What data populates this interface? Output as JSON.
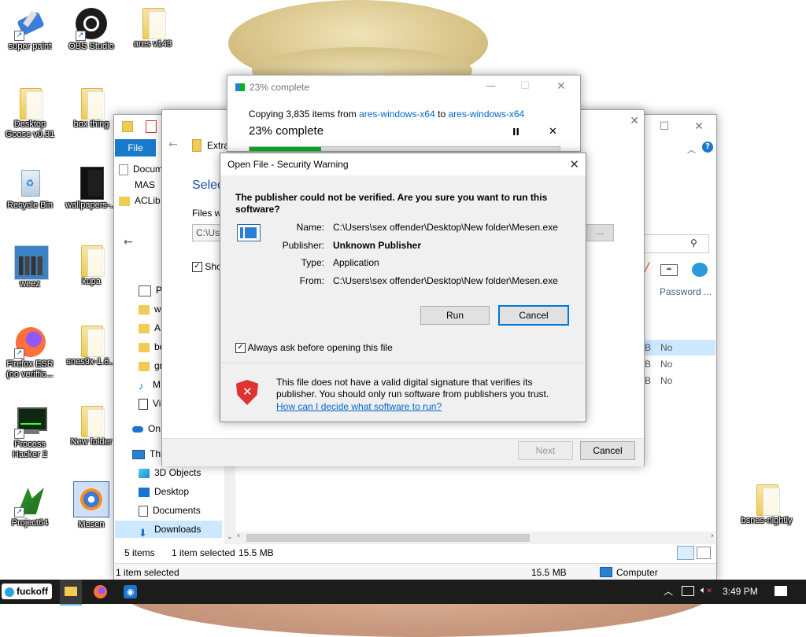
{
  "desktop": {
    "icons": [
      {
        "label": "super paint"
      },
      {
        "label": "OBS Studio"
      },
      {
        "label": "ares v143"
      },
      {
        "label": "Desktop\nGoose v0.31"
      },
      {
        "label": "box thing"
      },
      {
        "label": "Recycle Bin"
      },
      {
        "label": "wallpapers-..."
      },
      {
        "label": "weez"
      },
      {
        "label": "kupa"
      },
      {
        "label": "Firefox ESR\n(no veriffic..."
      },
      {
        "label": "snes9x-1.6..."
      },
      {
        "label": "Process\nHacker 2"
      },
      {
        "label": "New folder"
      },
      {
        "label": "Project64"
      },
      {
        "label": "Mesen"
      },
      {
        "label": "bsnes-nightly"
      }
    ]
  },
  "copy_dialog": {
    "title": "23% complete",
    "copying_prefix": "Copying 3,835 items from",
    "source": "ares-windows-x64",
    "to_word": "to",
    "destination": "ares-windows-x64",
    "progress_text": "23% complete",
    "progress_fraction": 0.23,
    "pause_label": "II",
    "cancel_label": "✕"
  },
  "extract_wizard": {
    "title": "Extra",
    "heading": "Selec",
    "files_label": "Files w",
    "path_value": "C:\\Us",
    "show_label": "Sho",
    "next_label": "Next",
    "cancel_label": "Cancel"
  },
  "explorer": {
    "file_tab": "File",
    "quick_items": [
      "Docum",
      "MAS",
      "ACLib"
    ],
    "nav_items": [
      "Pi",
      "w",
      "A",
      "be",
      "gr",
      "M",
      "Vi"
    ],
    "onedrive": "On",
    "thispc": "Thi",
    "locations": [
      "3D Objects",
      "Desktop",
      "Documents",
      "Downloads"
    ],
    "column_header": "Password ...",
    "rows": [
      {
        "size_tail": "B",
        "password": "No"
      },
      {
        "size_tail": "B",
        "password": "No"
      },
      {
        "size_tail": "B",
        "password": "No"
      }
    ],
    "status_items": "5 items",
    "status_selected": "1 item selected",
    "status_size": "15.5 MB",
    "bottom_selected": "1 item selected",
    "bottom_size": "15.5 MB",
    "bottom_location": "Computer"
  },
  "security_dialog": {
    "title": "Open File - Security Warning",
    "question": "The publisher could not be verified.  Are you sure you want to run this software?",
    "name_label": "Name:",
    "name_value": "C:\\Users\\sex offender\\Desktop\\New folder\\Mesen.exe",
    "publisher_label": "Publisher:",
    "publisher_value": "Unknown Publisher",
    "type_label": "Type:",
    "type_value": "Application",
    "from_label": "From:",
    "from_value": "C:\\Users\\sex offender\\Desktop\\New folder\\Mesen.exe",
    "run_label": "Run",
    "cancel_label": "Cancel",
    "always_ask_label": "Always ask before opening this file",
    "always_ask_checked": true,
    "warning_text": "This file does not have a valid digital signature that verifies its publisher.  You should only run software from publishers you trust.",
    "help_link": "How can I decide what software to run?"
  },
  "taskbar": {
    "start_label": "fuckoff",
    "time": "3:49 PM"
  },
  "colors": {
    "accent": "#0078d7",
    "link": "#0066cc",
    "progress": "#06b025",
    "taskbar": "#1c1c1c"
  }
}
